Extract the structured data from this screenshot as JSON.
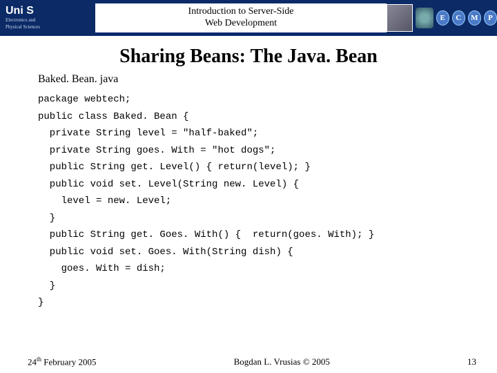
{
  "header": {
    "logo": "Uni S",
    "dept_line1": "Electronics and",
    "dept_line2": "Physical Sciences",
    "title_line1": "Introduction to Server-Side",
    "title_line2": "Web Development",
    "badges": [
      "E",
      "C",
      "M",
      "P"
    ]
  },
  "slide": {
    "title": "Sharing Beans: The Java. Bean",
    "filename": "Baked. Bean. java",
    "code": "package webtech;\npublic class Baked. Bean {\n  private String level = \"half-baked\";\n  private String goes. With = \"hot dogs\";\n  public String get. Level() { return(level); }\n  public void set. Level(String new. Level) {\n    level = new. Level;\n  }\n  public String get. Goes. With() {  return(goes. With); }\n  public void set. Goes. With(String dish) {\n    goes. With = dish;\n  }\n}"
  },
  "footer": {
    "date_prefix": "24",
    "date_sup": "th",
    "date_suffix": " February 2005",
    "author": "Bogdan L. Vrusias © 2005",
    "page": "13"
  }
}
